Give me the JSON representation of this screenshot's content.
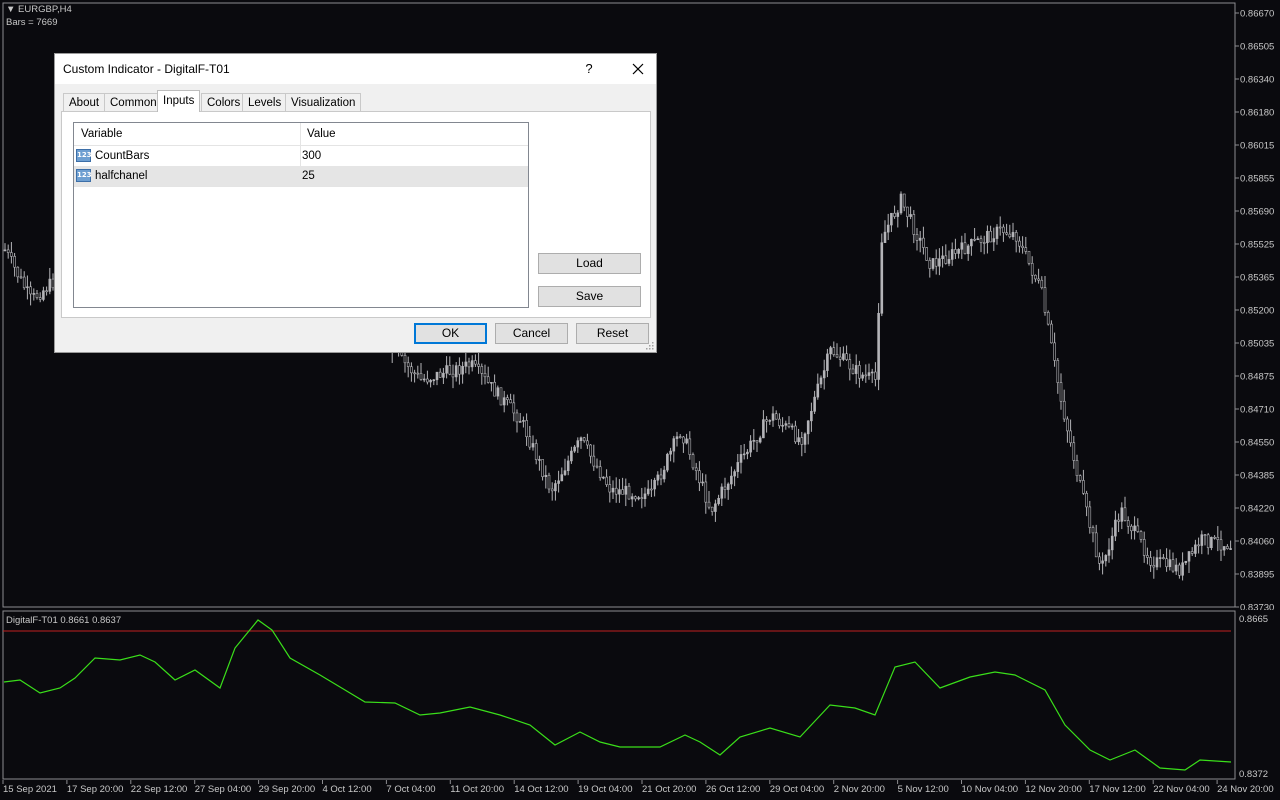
{
  "chart": {
    "symbol": "EURGBP,H4",
    "bars_label": "Bars = 7669",
    "price_labels": [
      "0.86670",
      "0.86505",
      "0.86340",
      "0.86180",
      "0.86015",
      "0.85855",
      "0.85690",
      "0.85525",
      "0.85365",
      "0.85200",
      "0.85035",
      "0.84875",
      "0.84710",
      "0.84550",
      "0.84385",
      "0.84220",
      "0.84060",
      "0.83895",
      "0.83730"
    ],
    "date_labels": [
      "15 Sep 2021",
      "17 Sep 20:00",
      "22 Sep 12:00",
      "27 Sep 04:00",
      "29 Sep 20:00",
      "4 Oct 12:00",
      "7 Oct 04:00",
      "11 Oct 20:00",
      "14 Oct 12:00",
      "19 Oct 04:00",
      "21 Oct 20:00",
      "26 Oct 12:00",
      "29 Oct 04:00",
      "2 Nov 20:00",
      "5 Nov 12:00",
      "10 Nov 04:00",
      "12 Nov 20:00",
      "17 Nov 12:00",
      "22 Nov 04:00",
      "24 Nov 20:00"
    ],
    "colors": {
      "background": "#0a0a0e",
      "candle": "#b4b4b8",
      "grid_frame": "#8c8c90",
      "indicator_line": "#3adf1a",
      "level_line": "#c02020"
    }
  },
  "indicator_window": {
    "label": "DigitalF-T01 0.8661 0.8637",
    "scale_top": "0.8665",
    "scale_bottom": "0.8372"
  },
  "dialog": {
    "title": "Custom Indicator - DigitalF-T01",
    "help_label": "?",
    "close_icon": "close-icon",
    "tabs": [
      {
        "label": "About"
      },
      {
        "label": "Common"
      },
      {
        "label": "Inputs"
      },
      {
        "label": "Colors"
      },
      {
        "label": "Levels"
      },
      {
        "label": "Visualization"
      }
    ],
    "active_tab": "Inputs",
    "grid": {
      "headers": {
        "variable": "Variable",
        "value": "Value"
      },
      "rows": [
        {
          "icon": "numeric-param-icon",
          "icon_text": "123",
          "name": "CountBars",
          "value": "300"
        },
        {
          "icon": "numeric-param-icon",
          "icon_text": "123",
          "name": "halfchanel",
          "value": "25"
        }
      ]
    },
    "load_label": "Load",
    "save_label": "Save",
    "ok_label": "OK",
    "cancel_label": "Cancel",
    "reset_label": "Reset"
  }
}
